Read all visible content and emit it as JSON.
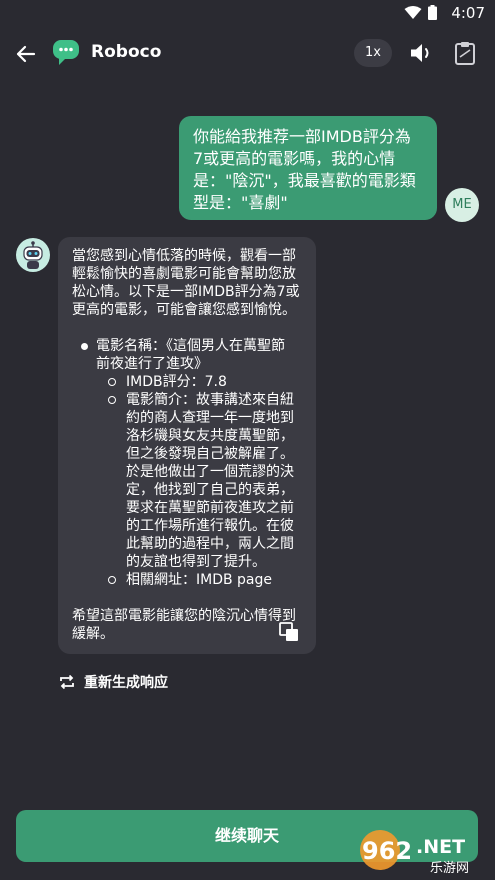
{
  "status": {
    "time": "4:07"
  },
  "app_bar": {
    "title": "Roboco",
    "speed": "1x"
  },
  "user_message": {
    "lines": [
      "你能給我推荐一部IMDB評分為",
      "7或更高的電影嗎，我的心情",
      "是：\"陰沉\"，我最喜歡的電影類",
      "型是：\"喜劇\""
    ],
    "avatar": "ME"
  },
  "bot_message": {
    "intro": [
      "當您感到心情低落的時候，觀看一部",
      "輕鬆愉快的喜劇電影可能會幫助您放",
      "松心情。以下是一部IMDB評分為7或",
      "更高的電影，可能會讓您感到愉悅。"
    ],
    "movie_title": [
      "電影名稱：《這個男人在萬聖節",
      "前夜進行了進攻》"
    ],
    "rating": "IMDB評分：7.8",
    "summary": [
      "電影簡介：故事講述來自紐",
      "約的商人查理一年一度地到",
      "洛杉磯與女友共度萬聖節，",
      "但之後發現自己被解雇了。",
      "於是他做出了一個荒謬的決",
      "定，他找到了自己的表弟，",
      "要求在萬聖節前夜進攻之前",
      "的工作場所進行報仇。在彼",
      "此幫助的過程中，兩人之間",
      "的友誼也得到了提升。"
    ],
    "link": "相關網址：IMDB page",
    "closing": [
      "希望這部電影能讓您的陰沉心情得到",
      "緩解。"
    ]
  },
  "regenerate_label": "重新生成响应",
  "continue_label": "继续聊天",
  "watermark": {
    "number": "962",
    "suffix": ".NET",
    "caption": "乐游网"
  },
  "colors": {
    "background": "#2a2a31",
    "accent": "#3b9b73",
    "bubble": "#3b3b43"
  }
}
